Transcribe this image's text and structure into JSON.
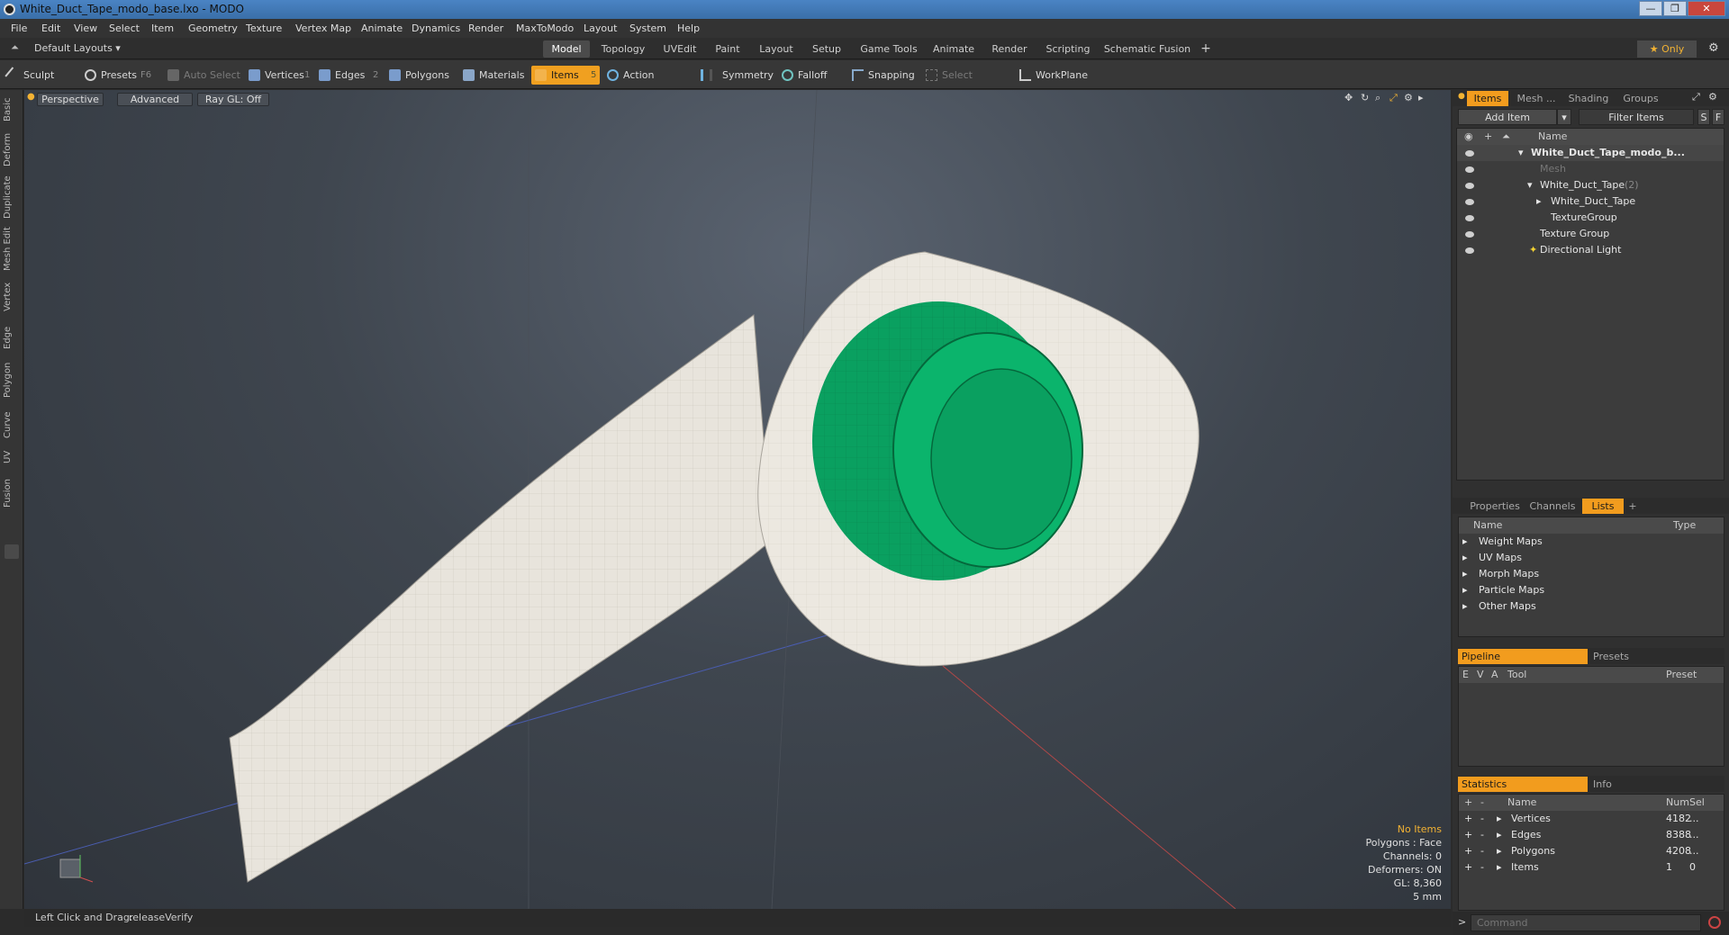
{
  "window": {
    "title": "White_Duct_Tape_modo_base.lxo - MODO",
    "minimize": "—",
    "maximize": "❐",
    "close": "✕"
  },
  "menu": [
    "File",
    "Edit",
    "View",
    "Select",
    "Item",
    "Geometry",
    "Texture",
    "Vertex Map",
    "Animate",
    "Dynamics",
    "Render",
    "MaxToModo",
    "Layout",
    "System",
    "Help"
  ],
  "layout_selector": "Default Layouts ▾",
  "tabs": [
    "Model",
    "Topology",
    "UVEdit",
    "Paint",
    "Layout",
    "Setup",
    "Game Tools",
    "Animate",
    "Render",
    "Scripting",
    "Schematic Fusion",
    "+"
  ],
  "only_label": "★ Only",
  "toolbar": {
    "sculpt": "Sculpt",
    "presets": "Presets",
    "presets_key": "F6",
    "auto_select": "Auto Select",
    "vertices": "Vertices",
    "vertices_key": "1",
    "edges": "Edges",
    "edges_key": "2",
    "polygons": "Polygons",
    "materials": "Materials",
    "items": "Items",
    "items_key": "5",
    "action_center": "Action Center",
    "symmetry": "Symmetry",
    "falloff": "Falloff",
    "snapping": "Snapping",
    "select_through": "Select Through",
    "workplane": "WorkPlane"
  },
  "left_tabs": [
    "Basic",
    "Deform",
    "Duplicate",
    "Mesh Edit",
    "Vertex",
    "Edge",
    "Polygon",
    "Curve",
    "UV",
    "Fusion"
  ],
  "viewport": {
    "perspective": "Perspective",
    "advanced": "Advanced",
    "raygl": "Ray GL: Off",
    "stats": [
      "No Items",
      "Polygons : Face",
      "Channels: 0",
      "Deformers: ON",
      "GL: 8,360",
      "5 mm"
    ]
  },
  "status": {
    "hint": "Left Click and Drag:",
    "action": "releaseVerify"
  },
  "items_panel": {
    "tabs": [
      "Items",
      "Mesh ...",
      "Shading",
      "Groups"
    ],
    "add_item": "Add Item",
    "filter": "Filter Items",
    "s": "S",
    "f": "F",
    "name_header": "Name",
    "tree": [
      {
        "label": "White_Duct_Tape_modo_b...",
        "indent": 0,
        "bold": true
      },
      {
        "label": "Mesh",
        "indent": 1,
        "dim": true
      },
      {
        "label": "White_Duct_Tape",
        "suffix": "(2)",
        "indent": 1
      },
      {
        "label": "White_Duct_Tape",
        "indent": 2
      },
      {
        "label": "TextureGroup",
        "indent": 2
      },
      {
        "label": "Texture Group",
        "indent": 1
      },
      {
        "label": "Directional Light",
        "indent": 1
      }
    ]
  },
  "lists_panel": {
    "tabs": [
      "Properties",
      "Channels",
      "Lists",
      "+"
    ],
    "name": "Name",
    "type": "Type",
    "rows": [
      "Weight Maps",
      "UV Maps",
      "Morph Maps",
      "Particle Maps",
      "Other Maps"
    ]
  },
  "pipeline_panel": {
    "tabs": [
      "Pipeline",
      "Presets"
    ],
    "cols": [
      "E",
      "V",
      "A",
      "Tool",
      "Preset"
    ]
  },
  "stats_panel": {
    "tabs": [
      "Statistics",
      "Info"
    ],
    "cols": [
      "+",
      "-",
      "Name",
      "Num",
      "Sel"
    ],
    "rows": [
      {
        "name": "Vertices",
        "num": "4182",
        "sel": "..."
      },
      {
        "name": "Edges",
        "num": "8388",
        "sel": "..."
      },
      {
        "name": "Polygons",
        "num": "4208",
        "sel": "..."
      },
      {
        "name": "Items",
        "num": "1",
        "sel": "0"
      }
    ]
  },
  "command": {
    "placeholder": "Command"
  },
  "colors": {
    "accent": "#f29c1e",
    "tape_core": "#0aa060",
    "tape": "#e8e4dc"
  }
}
